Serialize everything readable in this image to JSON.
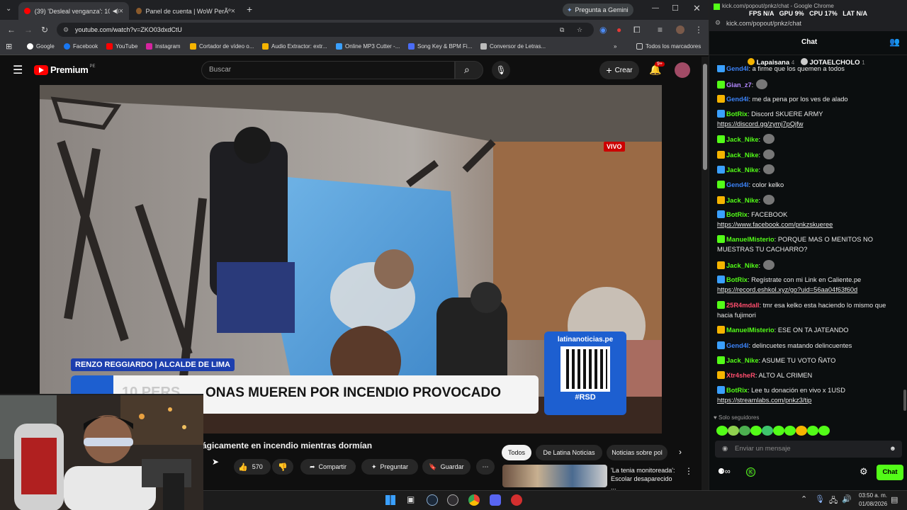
{
  "tabs": [
    {
      "title": "(39) 'Desleal venganza': 10 ",
      "active": true
    },
    {
      "title": "Panel de cuenta | WoW PerÃº",
      "active": false
    }
  ],
  "gemini_label": "Pregunta a Gemini",
  "url": "youtube.com/watch?v=ZKO03dxdCtU",
  "bookmarks": [
    "Google",
    "Facebook",
    "YouTube",
    "Instagram",
    "Cortador de vídeo o...",
    "Audio Extractor: extr...",
    "Online MP3 Cutter -...",
    "Song Key & BPM Fi...",
    "Conversor de Letras..."
  ],
  "all_bookmarks": "Todos los marcadores",
  "yt": {
    "logo": "Premium",
    "logo_sup": "PE",
    "search_placeholder": "Buscar",
    "create": "Crear",
    "notif_count": "9+"
  },
  "video": {
    "live_badge": "VIVO",
    "lower_name": "RENZO REGGIARDO | ALCALDE DE LIMA",
    "headline": "ONAS MUEREN POR INCENDIO PROVOCADO",
    "headline_prefix": "10 PERS",
    "qr_site": "latinanoticias.pe",
    "qr_tag": "#RSD"
  },
  "below": {
    "title": "ágicamente en incendio mientras dormían",
    "likes": "570",
    "share": "Compartir",
    "ask": "Preguntar",
    "save": "Guardar",
    "chips": [
      "Todos",
      "De Latina Noticias",
      "Noticias sobre pol"
    ],
    "rec_title": "'La tenia monitoreada': Escolar desaparecido ..."
  },
  "chat": {
    "overlay_url": "kick.com/popout/pnkz/chat - Google Chrome",
    "stats": "FPS N/A   GPU 9%   CPU 17%   LAT N/A",
    "url": "kick.com/popout/pnkz/chat",
    "title": "Chat",
    "pinned": [
      {
        "name": "Lapaisana",
        "count": "4"
      },
      {
        "name": "JOTAELCHOLO",
        "count": "1"
      }
    ],
    "messages": [
      {
        "user": "Gend4l",
        "color": "#3b82f6",
        "text": ": a firme que los quemen a todos"
      },
      {
        "user": "Gian_z7",
        "color": "#b388ff",
        "text": ":"
      },
      {
        "user": "Gend4l",
        "color": "#3b82f6",
        "text": ": me da pena por los ves de alado"
      },
      {
        "user": "BotRix",
        "color": "#53fc18",
        "text": ": Discord SKUERE ARMY",
        "link": "https://discord.gg/zymj7pQjfw"
      },
      {
        "user": "Jack_Nike",
        "color": "#53fc18",
        "text": ":"
      },
      {
        "user": "Jack_Nike",
        "color": "#53fc18",
        "text": ":"
      },
      {
        "user": "Jack_Nike",
        "color": "#53fc18",
        "text": ":"
      },
      {
        "user": "Gend4l",
        "color": "#3b82f6",
        "text": ": color kelko"
      },
      {
        "user": "Jack_Nike",
        "color": "#53fc18",
        "text": ":"
      },
      {
        "user": "BotRix",
        "color": "#53fc18",
        "text": ": FACEBOOK",
        "link": "https://www.facebook.com/pnkzskueree"
      },
      {
        "user": "ManuelMisterio",
        "color": "#53fc18",
        "text": ": PORQUE MAS O MENITOS NO MUESTRAS TU CACHARRO?"
      },
      {
        "user": "Jack_Nike",
        "color": "#53fc18",
        "text": ":"
      },
      {
        "user": "BotRix",
        "color": "#53fc18",
        "text": ": Regístrate con mi Link en Caliente.pe",
        "link": "https://record.eshkol.xyz/go?uid=56aa04f63f60d"
      },
      {
        "user": "25R4mdall",
        "color": "#ff4d6d",
        "text": ": tmr esa kelko esta haciendo lo mismo que hacia fujimori"
      },
      {
        "user": "ManuelMisterio",
        "color": "#53fc18",
        "text": ": ESE ON TA JATEANDO"
      },
      {
        "user": "Gend4l",
        "color": "#3b82f6",
        "text": ": delincuetes matando delincuentes"
      },
      {
        "user": "Jack_Nike",
        "color": "#53fc18",
        "text": ": ASUME TU VOTO ÑATO"
      },
      {
        "user": "Xtr4sheR",
        "color": "#ff4d6d",
        "text": ": ALTO AL CRIMEN"
      },
      {
        "user": "BotRix",
        "color": "#53fc18",
        "text": ": Lee tu donación en vivo x 1USD",
        "link": "https://streamlabs.com/pnkz3/tip"
      }
    ],
    "followers_only": "Solo seguidores",
    "input_placeholder": "Enviar un mensaje",
    "send": "Chat"
  },
  "taskbar": {
    "time": "03:50 a. m.",
    "date": "01/08/2026"
  }
}
